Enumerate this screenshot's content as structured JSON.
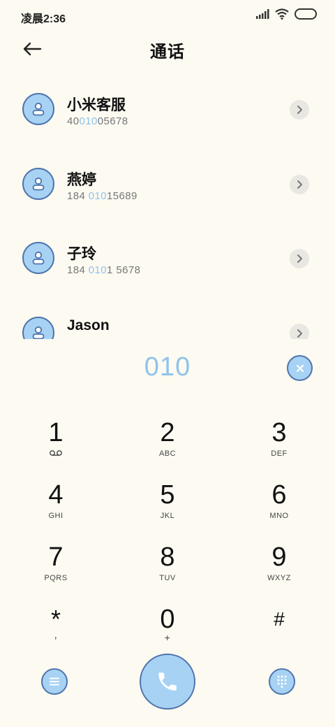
{
  "status_bar": {
    "time": "凌晨2:36"
  },
  "header": {
    "title": "通话"
  },
  "contacts": [
    {
      "name": "小米客服",
      "number_prefix": "40",
      "number_match": "010",
      "number_suffix": "05678"
    },
    {
      "name": "燕婷",
      "number_prefix": "184 ",
      "number_match": "010",
      "number_suffix": "15689"
    },
    {
      "name": "子玲",
      "number_prefix": "184 ",
      "number_match": "010",
      "number_suffix": "1 5678"
    },
    {
      "name": "Jason",
      "number_prefix": "",
      "number_match": "",
      "number_suffix": ""
    }
  ],
  "dialer": {
    "input": "010",
    "keys": [
      {
        "digit": "1",
        "sub": "voicemail-icon"
      },
      {
        "digit": "2",
        "sub": "ABC"
      },
      {
        "digit": "3",
        "sub": "DEF"
      },
      {
        "digit": "4",
        "sub": "GHI"
      },
      {
        "digit": "5",
        "sub": "JKL"
      },
      {
        "digit": "6",
        "sub": "MNO"
      },
      {
        "digit": "7",
        "sub": "PQRS"
      },
      {
        "digit": "8",
        "sub": "TUV"
      },
      {
        "digit": "9",
        "sub": "WXYZ"
      },
      {
        "digit": "*",
        "sub": ","
      },
      {
        "digit": "0",
        "sub": "+"
      },
      {
        "digit": "#",
        "sub": ""
      }
    ]
  },
  "colors": {
    "background": "#fcfaf1",
    "accent": "#a7d2f4",
    "accent_border": "#4e74ad",
    "highlight_text": "#8fc3ec"
  }
}
